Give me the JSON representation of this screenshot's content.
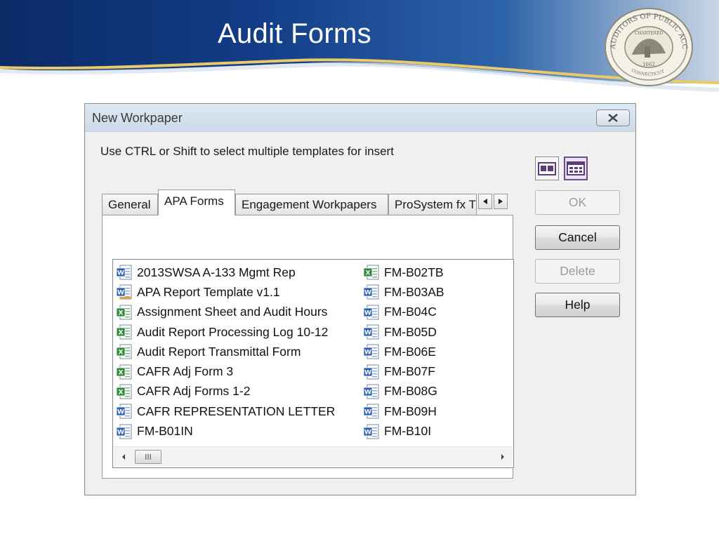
{
  "slide": {
    "title": "Audit Forms",
    "seal_text": "AUDITORS OF PUBLIC ACCOUNTS · CHARTERED · 1662 · CONNECTICUT"
  },
  "dialog": {
    "title": "New Workpaper",
    "instruction": "Use CTRL or Shift to select multiple templates for insert",
    "tabs": [
      {
        "label": "General"
      },
      {
        "label": "APA Forms"
      },
      {
        "label": "Engagement Workpapers"
      },
      {
        "label": "ProSystem fx T"
      }
    ],
    "active_tab": "APA Forms",
    "files_col1": [
      {
        "name": "2013SWSA A-133 Mgmt Rep",
        "type": "word"
      },
      {
        "name": "APA Report Template v1.1",
        "type": "word-template"
      },
      {
        "name": "Assignment Sheet and Audit Hours",
        "type": "excel"
      },
      {
        "name": "Audit Report Processing Log 10-12",
        "type": "excel"
      },
      {
        "name": "Audit Report Transmittal Form",
        "type": "excel"
      },
      {
        "name": "CAFR Adj Form 3",
        "type": "excel"
      },
      {
        "name": "CAFR Adj Forms 1-2",
        "type": "excel"
      },
      {
        "name": "CAFR REPRESENTATION LETTER",
        "type": "word"
      },
      {
        "name": "FM-B01IN",
        "type": "word"
      }
    ],
    "files_col2": [
      {
        "name": "FM-B02TB",
        "type": "excel"
      },
      {
        "name": "FM-B03AB",
        "type": "word"
      },
      {
        "name": "FM-B04C",
        "type": "word"
      },
      {
        "name": "FM-B05D",
        "type": "word"
      },
      {
        "name": "FM-B06E",
        "type": "word"
      },
      {
        "name": "FM-B07F",
        "type": "word"
      },
      {
        "name": "FM-B08G",
        "type": "word"
      },
      {
        "name": "FM-B09H",
        "type": "word"
      },
      {
        "name": "FM-B10I",
        "type": "word"
      }
    ],
    "buttons": {
      "ok": "OK",
      "cancel": "Cancel",
      "delete": "Delete",
      "help": "Help"
    },
    "scroll_thumb_label": "III"
  },
  "colors": {
    "banner_dark": "#0d2d6b",
    "banner_mid": "#1e5aa8",
    "banner_accent": "#e8c95a",
    "word_blue": "#2b5fb4",
    "excel_green": "#2e8b3a",
    "selected_view_border": "#6b4f8b"
  }
}
